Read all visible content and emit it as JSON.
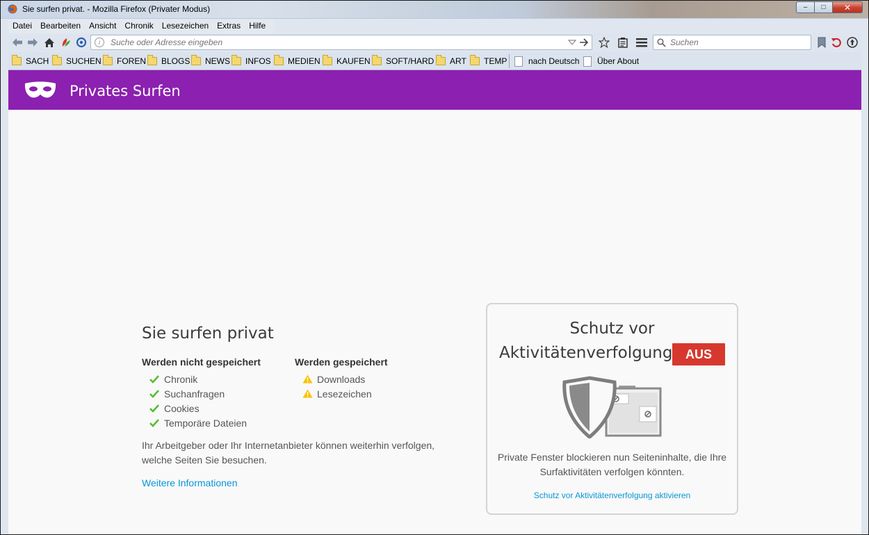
{
  "window": {
    "title": "Sie surfen privat. - Mozilla Firefox (Privater Modus)"
  },
  "menu": [
    "Datei",
    "Bearbeiten",
    "Ansicht",
    "Chronik",
    "Lesezeichen",
    "Extras",
    "Hilfe"
  ],
  "navbar": {
    "url_placeholder": "Suche oder Adresse eingeben",
    "search_placeholder": "Suchen"
  },
  "bookmarks": {
    "folders": [
      "SACH",
      "SUCHEN",
      "FOREN",
      "BLOGS",
      "NEWS",
      "INFOS",
      "MEDIEN",
      "KAUFEN",
      "SOFT/HARD",
      "ART",
      "TEMP"
    ],
    "pages": [
      "nach Deutsch",
      "Über About"
    ]
  },
  "banner": {
    "label": "Privates Surfen"
  },
  "private_info": {
    "heading": "Sie surfen privat",
    "not_saved_title": "Werden nicht gespeichert",
    "not_saved": [
      "Chronik",
      "Suchanfragen",
      "Cookies",
      "Temporäre Dateien"
    ],
    "saved_title": "Werden gespeichert",
    "saved": [
      "Downloads",
      "Lesezeichen"
    ],
    "note": "Ihr Arbeitgeber oder Ihr Internetanbieter können weiterhin verfolgen, welche Seiten Sie besuchen.",
    "more_link": "Weitere Informationen"
  },
  "tracking_protection": {
    "title_line1": "Schutz vor",
    "title_line2": "Aktivitätenverfolgung",
    "status": "AUS",
    "description": "Private Fenster blockieren nun Seiteninhalte, die Ihre Surfaktivitäten verfolgen könnten.",
    "activate_link": "Schutz vor Aktivitätenverfolgung aktivieren"
  },
  "colors": {
    "private_purple": "#8c20b0",
    "off_red": "#d7382e",
    "link_blue": "#0996d3",
    "check_green": "#57bd35",
    "warn_yellow": "#ffbf00"
  }
}
